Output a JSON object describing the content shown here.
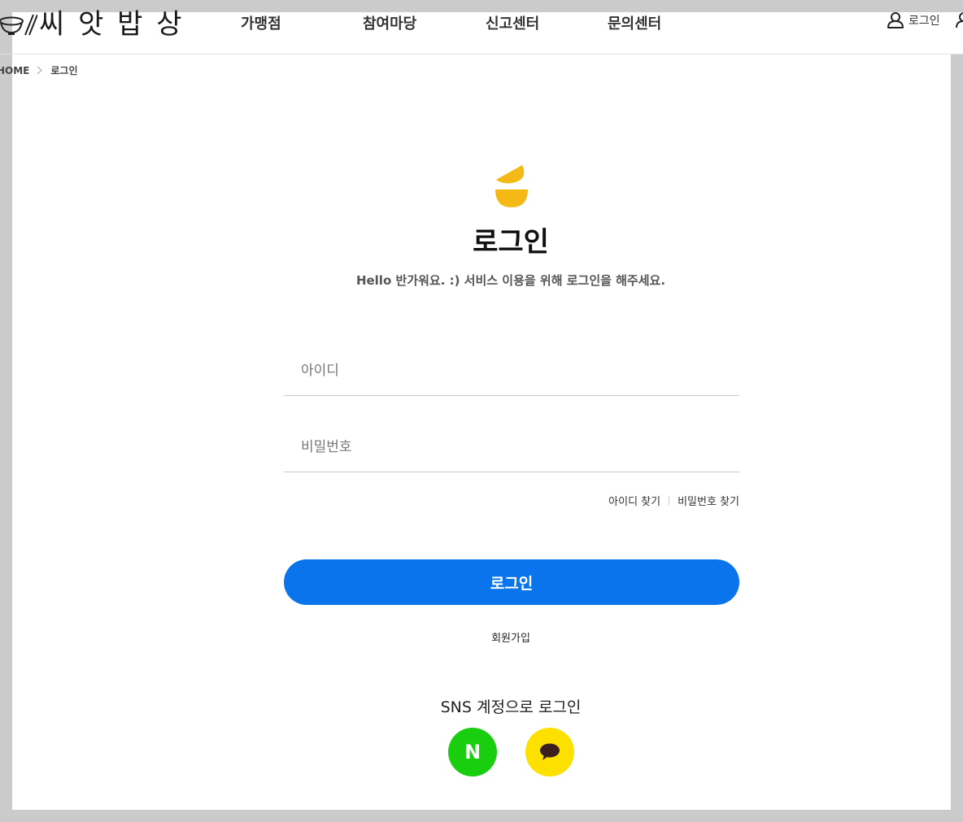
{
  "header": {
    "logo_text": "씨 앗 밥 상",
    "nav": [
      "가맹점",
      "참여마당",
      "신고센터",
      "문의센터"
    ],
    "login_label": "로그인"
  },
  "breadcrumb": {
    "home": "HOME",
    "current": "로그인"
  },
  "login": {
    "title": "로그인",
    "subtitle": "Hello 반가워요. :) 서비스 이용을 위해 로그인을 해주세요.",
    "id_placeholder": "아이디",
    "id_value": "",
    "pw_placeholder": "비밀번호",
    "pw_value": "",
    "find_id": "아이디 찾기",
    "find_pw": "비밀번호 찾기",
    "submit": "로그인",
    "signup": "회원가입",
    "sns_title": "SNS 계정으로 로그인",
    "naver_letter": "N"
  },
  "colors": {
    "primary": "#0a74ec",
    "naver": "#19ce0f",
    "kakao": "#fce000",
    "kakao_bubble": "#3b1e1e",
    "logo_accent": "#f5b915"
  },
  "icons": [
    "rice-bowl-chopsticks-icon",
    "user-icon",
    "chevron-right-icon",
    "bowl-logo-icon",
    "naver-icon",
    "kakao-chat-icon"
  ]
}
